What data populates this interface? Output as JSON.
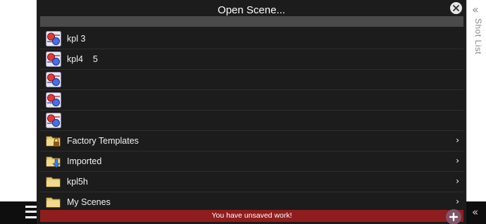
{
  "dialog": {
    "title": "Open Scene...",
    "close_icon": "close-icon"
  },
  "search": {
    "value": ""
  },
  "items": [
    {
      "type": "scene",
      "label": "kpl 3",
      "icon": "scene-icon"
    },
    {
      "type": "scene",
      "label": "kpl4    5",
      "icon": "scene-icon"
    },
    {
      "type": "scene",
      "label": "",
      "icon": "scene-icon"
    },
    {
      "type": "scene",
      "label": "",
      "icon": "scene-icon"
    },
    {
      "type": "scene",
      "label": "",
      "icon": "scene-icon"
    },
    {
      "type": "folder",
      "label": "Factory Templates",
      "icon": "locked-folder-icon",
      "chevron": "›"
    },
    {
      "type": "folder",
      "label": "Imported",
      "icon": "import-folder-icon",
      "chevron": "›"
    },
    {
      "type": "folder",
      "label": "kpl5h",
      "icon": "folder-icon",
      "chevron": "›"
    },
    {
      "type": "folder",
      "label": "My Scenes",
      "icon": "folder-icon",
      "chevron": "›"
    }
  ],
  "status": {
    "unsaved": "You have unsaved work!"
  },
  "sidebar": {
    "shot_list_label": "Shot List",
    "chevron": "«"
  },
  "colors": {
    "dialog_bg": "#1c1c1c",
    "unsaved_bg": "#8f1d1d",
    "fab_bg": "#7d5566"
  }
}
